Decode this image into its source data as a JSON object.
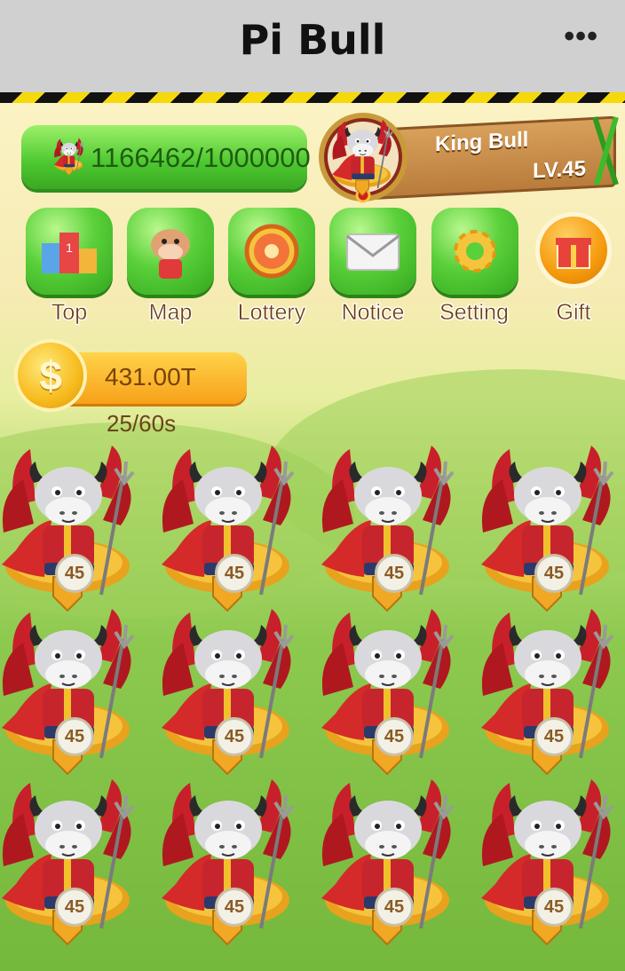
{
  "window": {
    "title": "Pi Bull",
    "menu_glyph": "•••"
  },
  "header": {
    "progress_text": "1166462/1000000",
    "player_name": "King Bull",
    "player_level": "LV.45"
  },
  "nav": [
    {
      "label": "Top",
      "icon": "ranking-podium-icon"
    },
    {
      "label": "Map",
      "icon": "bull-map-icon"
    },
    {
      "label": "Lottery",
      "icon": "lottery-wheel-icon"
    },
    {
      "label": "Notice",
      "icon": "envelope-icon"
    },
    {
      "label": "Setting",
      "icon": "gear-icon"
    },
    {
      "label": "Gift",
      "icon": "gift-box-icon"
    }
  ],
  "coins": {
    "amount": "431.00T",
    "timer": "25/60s",
    "symbol": "$"
  },
  "bulls": {
    "level_label": "45",
    "slots": [
      {
        "level": "45"
      },
      {
        "level": "45"
      },
      {
        "level": "45"
      },
      {
        "level": "45"
      },
      {
        "level": "45"
      },
      {
        "level": "45"
      },
      {
        "level": "45"
      },
      {
        "level": "45"
      },
      {
        "level": "45"
      },
      {
        "level": "45"
      },
      {
        "level": "45"
      },
      {
        "level": "45"
      }
    ]
  },
  "colors": {
    "accent_green": "#4cc72f",
    "coin_gold": "#f7a11a",
    "bull_red": "#c8202a",
    "text_brown": "#6b3d12"
  }
}
